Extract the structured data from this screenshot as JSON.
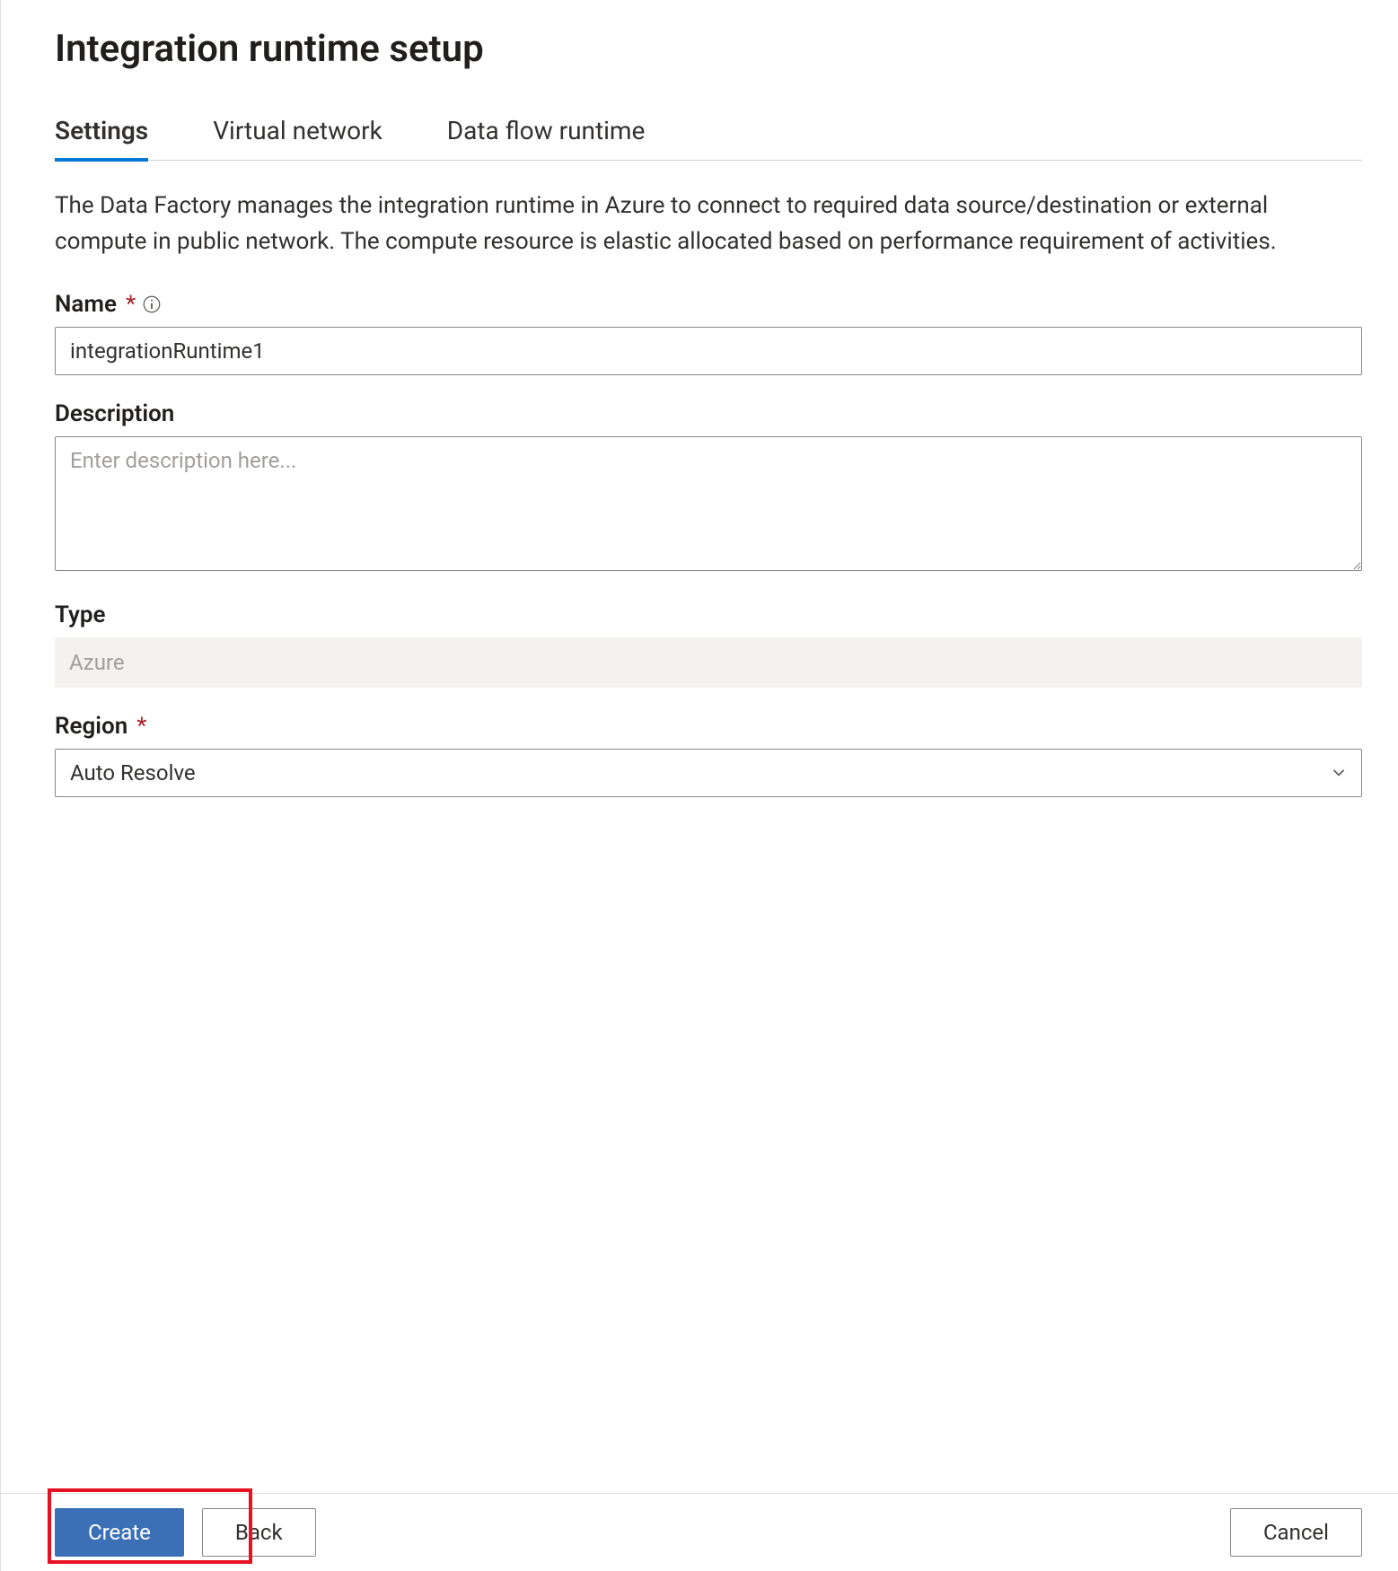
{
  "header": {
    "title": "Integration runtime setup"
  },
  "tabs": [
    {
      "label": "Settings",
      "active": true
    },
    {
      "label": "Virtual network",
      "active": false
    },
    {
      "label": "Data flow runtime",
      "active": false
    }
  ],
  "description": "The Data Factory manages the integration runtime in Azure to connect to required data source/destination or external compute in public network. The compute resource is elastic allocated based on performance requirement of activities.",
  "fields": {
    "name": {
      "label": "Name",
      "required": true,
      "info_icon": "info-icon",
      "value": "integrationRuntime1"
    },
    "description": {
      "label": "Description",
      "placeholder": "Enter description here...",
      "value": ""
    },
    "type": {
      "label": "Type",
      "value": "Azure"
    },
    "region": {
      "label": "Region",
      "required": true,
      "value": "Auto Resolve"
    }
  },
  "footer": {
    "create": "Create",
    "back": "Back",
    "cancel": "Cancel"
  },
  "colors": {
    "accent": "#0078d4",
    "primary_button": "#3b6fb6",
    "danger": "#e81123"
  }
}
